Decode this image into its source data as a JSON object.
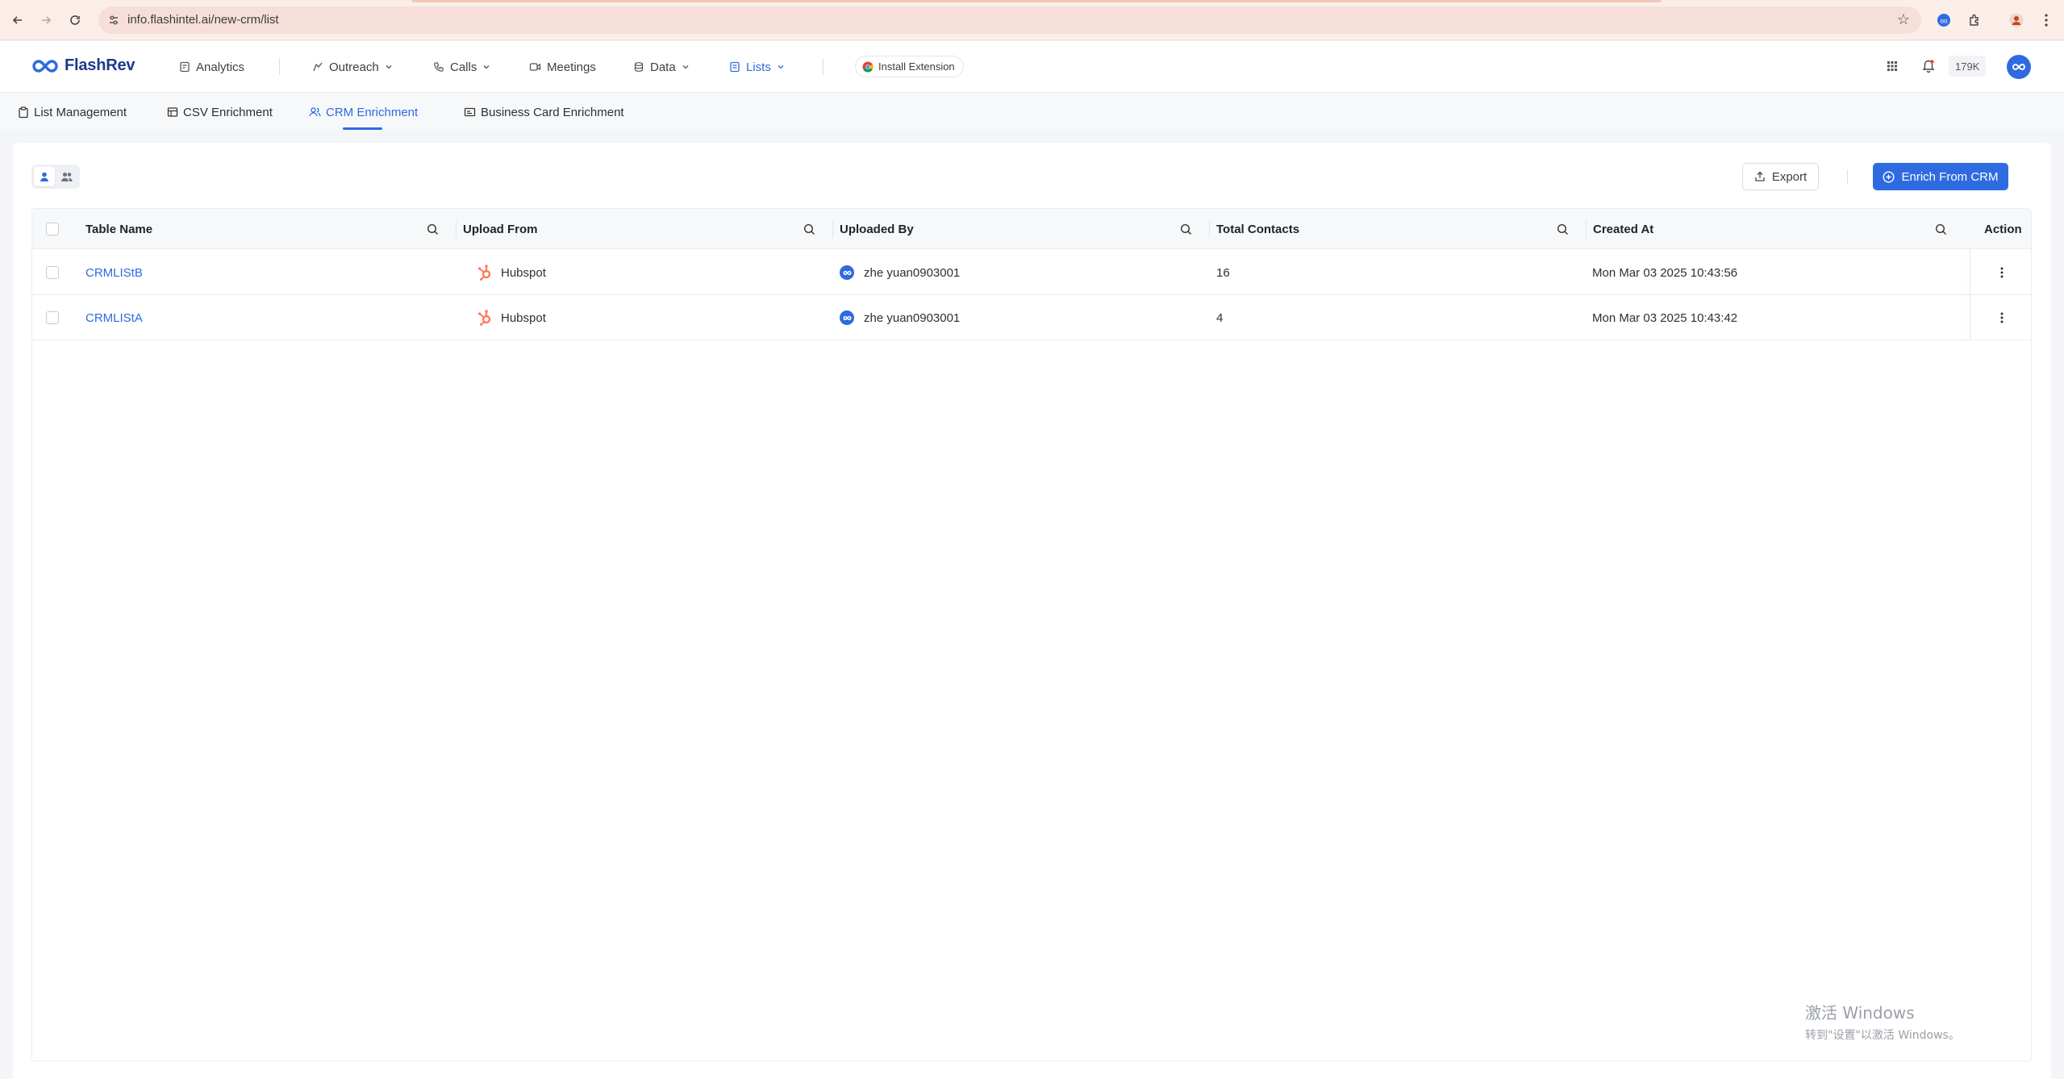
{
  "browser": {
    "url": "info.flashintel.ai/new-crm/list"
  },
  "header": {
    "logo_text": "FlashRev",
    "nav": [
      {
        "label": "Analytics"
      },
      {
        "label": "Outreach"
      },
      {
        "label": "Calls"
      },
      {
        "label": "Meetings"
      },
      {
        "label": "Data"
      },
      {
        "label": "Lists"
      }
    ],
    "install_extension": "Install Extension",
    "credits": "179K"
  },
  "subtabs": [
    {
      "label": "List Management"
    },
    {
      "label": "CSV Enrichment"
    },
    {
      "label": "CRM Enrichment"
    },
    {
      "label": "Business Card Enrichment"
    }
  ],
  "toolbar": {
    "export_label": "Export",
    "enrich_label": "Enrich From CRM"
  },
  "table": {
    "columns": [
      "Table Name",
      "Upload From",
      "Uploaded By",
      "Total Contacts",
      "Created At",
      "Action"
    ],
    "rows": [
      {
        "table_name": "CRMLIStB",
        "upload_from": "Hubspot",
        "uploaded_by": "zhe yuan0903001",
        "total_contacts": "16",
        "created_at": "Mon Mar 03 2025 10:43:56"
      },
      {
        "table_name": "CRMLIStA",
        "upload_from": "Hubspot",
        "uploaded_by": "zhe yuan0903001",
        "total_contacts": "4",
        "created_at": "Mon Mar 03 2025 10:43:42"
      }
    ]
  },
  "watermark": {
    "line1": "激活 Windows",
    "line2": "转到\"设置\"以激活 Windows。"
  },
  "colors": {
    "accent": "#2f6be0",
    "hubspot": "#ff7a59",
    "browser_bar": "#fbeee9"
  }
}
